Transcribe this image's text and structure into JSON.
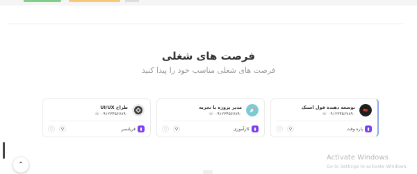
{
  "section": {
    "title": "فرصت های شغلی",
    "subtitle": "فرصت های شغلی مناسب خود را پیدا کنید"
  },
  "jobs": [
    {
      "title": "توسعه دهنده فول استک",
      "phone": "۰۹۱۲۳۴۵۶۷۸۹۰",
      "type": "پاره وقت",
      "logo_icon": "company-logo-dark",
      "logo_color": "#1e1e1e"
    },
    {
      "title": "مدیر پروژه با تجربه",
      "phone": "۰۹۱۲۳۴۵۶۷۸۹۰",
      "type": "کارآموزی",
      "logo_icon": "company-logo-teal",
      "logo_color": "#7ccbd3"
    },
    {
      "title": "طراح UI/UX",
      "phone": "۰۹۱۲۳۴۵۶۷۸۹۰",
      "type": "فریلنسر",
      "logo_icon": "company-logo-ornament",
      "logo_color": "#3a3a3a"
    }
  ],
  "colors": {
    "accent": "#7b3ff2",
    "active_border": "#8aa7e8"
  },
  "watermark": {
    "title": "Activate Windows",
    "subtitle": "Go to Settings to activate Windows."
  }
}
